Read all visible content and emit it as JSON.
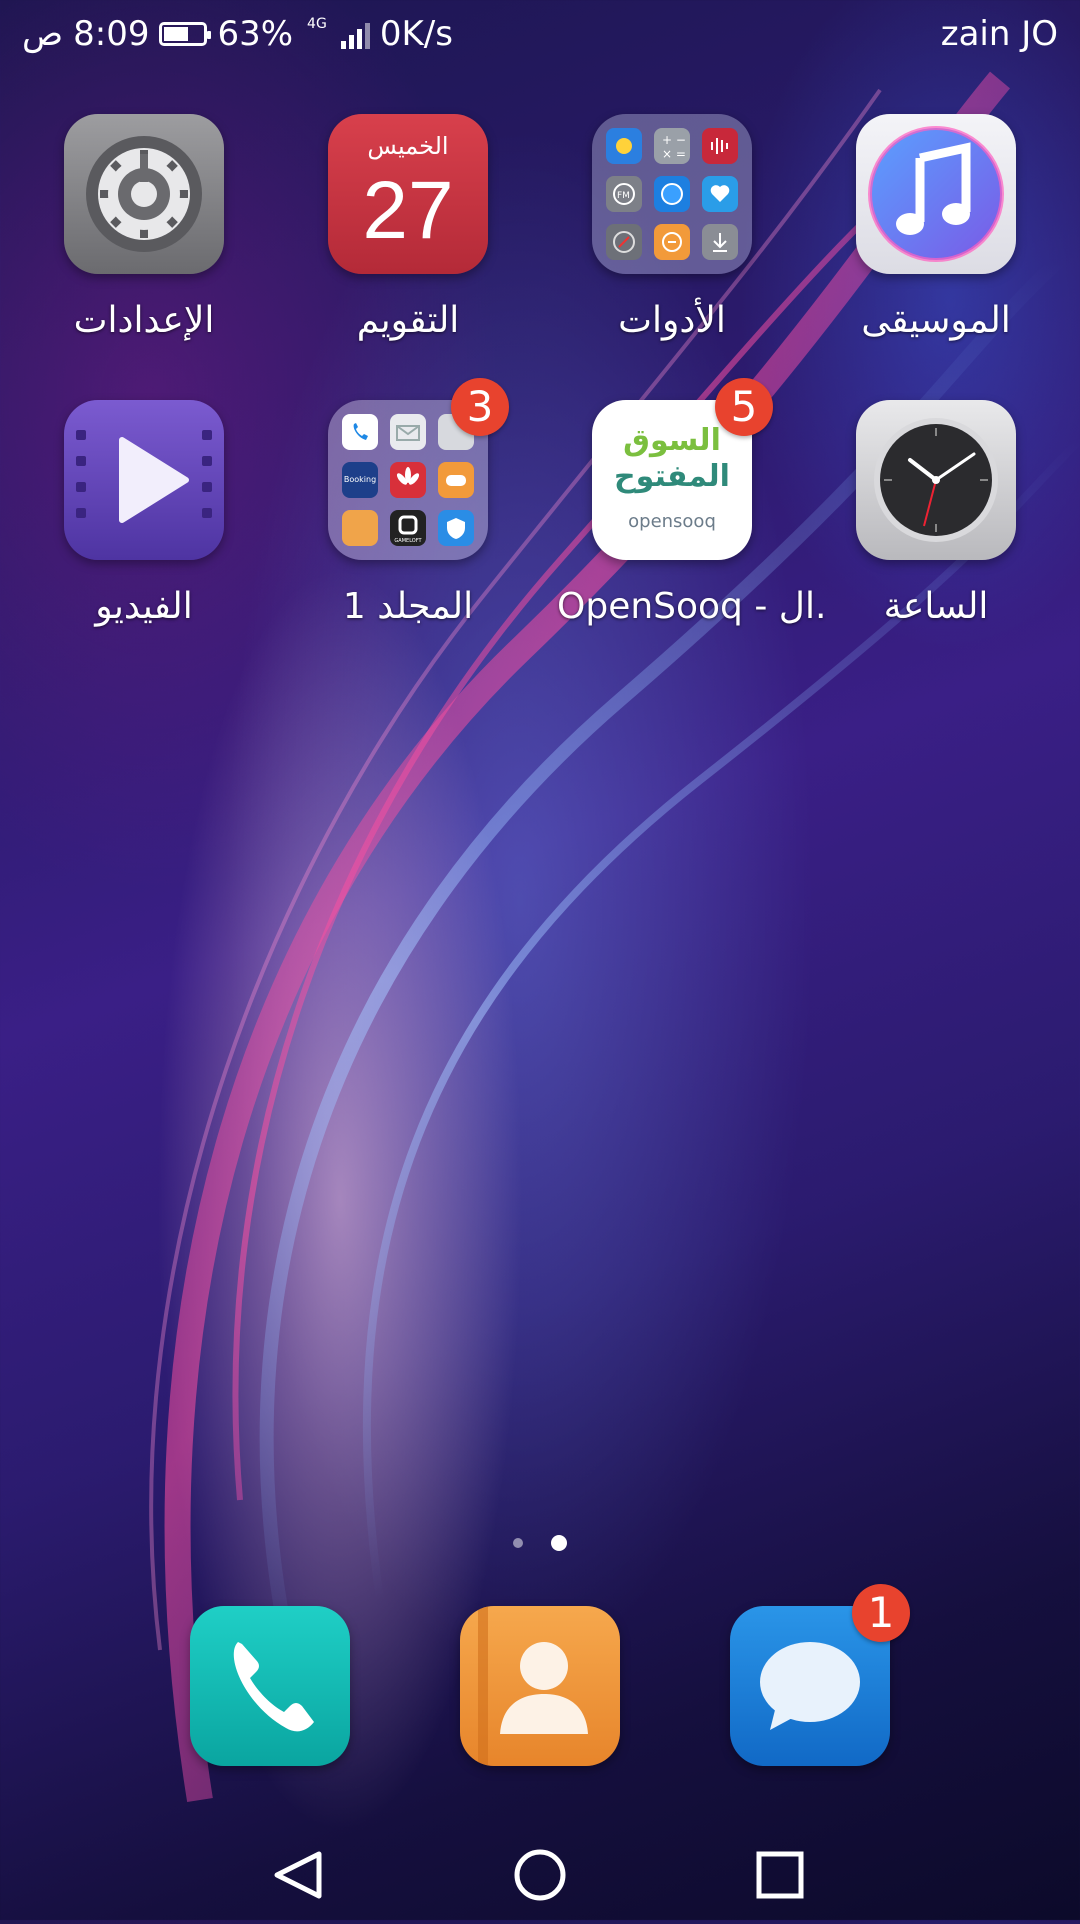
{
  "status_bar": {
    "time": "8:09",
    "period": "ص",
    "battery_percent": "63%",
    "battery_level": 0.63,
    "network_type": "4G",
    "data_speed": "0K/s",
    "carrier": "zain JO"
  },
  "apps": [
    {
      "id": "settings",
      "label": "الإعدادات",
      "icon": "gear-icon"
    },
    {
      "id": "calendar",
      "label": "التقويم",
      "icon": "calendar-icon",
      "day_name": "الخميس",
      "day_number": "27"
    },
    {
      "id": "tools",
      "label": "الأدوات",
      "icon": "tools-folder-icon"
    },
    {
      "id": "music",
      "label": "الموسيقى",
      "icon": "music-note-icon"
    },
    {
      "id": "video",
      "label": "الفيديو",
      "icon": "play-icon"
    },
    {
      "id": "folder1",
      "label": "المجلد 1",
      "icon": "folder-icon",
      "badge": "3"
    },
    {
      "id": "opensooq",
      "label": "OpenSooq - ال.",
      "icon": "opensooq-logo",
      "badge": "5",
      "logo_ar_line1": "السوق",
      "logo_ar_line2": "المفتوح",
      "logo_en": "opensooq"
    },
    {
      "id": "clock",
      "label": "الساعة",
      "icon": "clock-icon"
    }
  ],
  "folder_mini_labels": {
    "booking": "Booking",
    "gameloft": "GAMELOFT"
  },
  "page_indicator": {
    "count": 2,
    "active_index": 1
  },
  "dock": [
    {
      "id": "phone",
      "icon": "phone-icon"
    },
    {
      "id": "contacts",
      "icon": "contact-icon"
    },
    {
      "id": "messages",
      "icon": "message-bubble-icon",
      "badge": "1"
    }
  ],
  "nav_bar": [
    "back-icon",
    "home-icon",
    "recents-icon"
  ],
  "colors": {
    "badge": "#e8432e",
    "calendar": "#c83442",
    "phone": "#13bbb4",
    "contacts": "#ee9a3e",
    "messages": "#1d82d8",
    "video": "#6446bb"
  }
}
